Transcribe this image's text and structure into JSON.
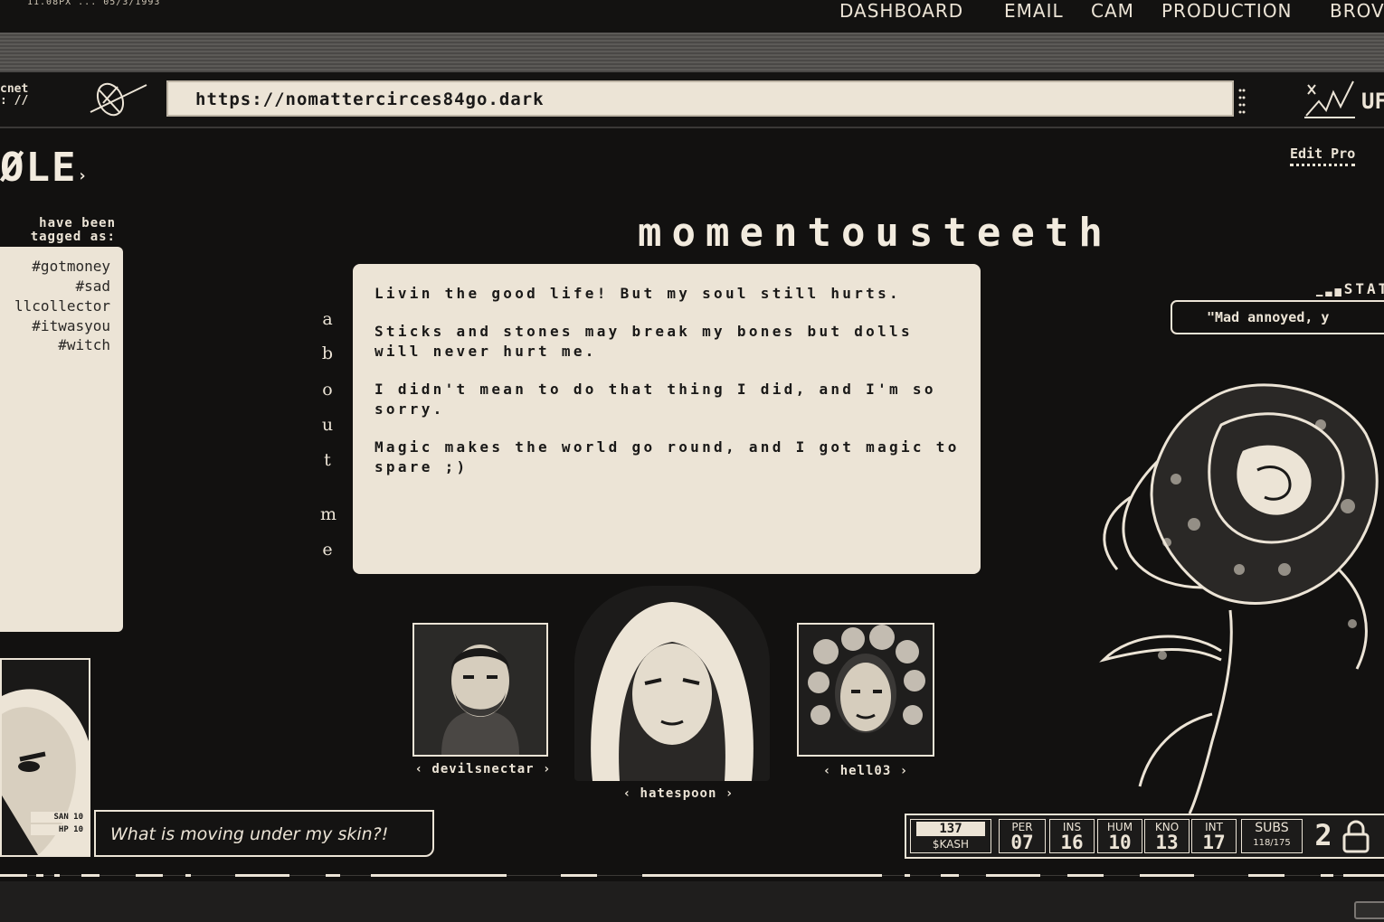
{
  "top_status": "11.08PX ... 05/3/1993",
  "nav": [
    {
      "label": "DASHBOARD"
    },
    {
      "label": "EMAIL"
    },
    {
      "label": "CAM"
    },
    {
      "label": "PRODUCTION"
    },
    {
      "label": "BROV"
    }
  ],
  "browser": {
    "network_label_line1": "cnet",
    "network_label_line2": ": //",
    "url": "https://nomattercirces84go.dark",
    "right_label": "UF"
  },
  "site": {
    "logo": "ØLE",
    "logo_suffix": "›",
    "edit_profile": "Edit Pro"
  },
  "tags": {
    "heading_line1": "have been",
    "heading_line2": "tagged as:",
    "items": [
      "#gotmoney",
      "#sad",
      "llcollector",
      "#itwasyou",
      "#witch"
    ]
  },
  "profile": {
    "name": "momentousteeth",
    "about_label": [
      "a",
      "b",
      "o",
      "u",
      "t",
      "m",
      "e"
    ],
    "about_paragraphs": [
      "Livin the good life! But my soul still hurts.",
      "Sticks and stones may break my bones but dolls will never hurt me.",
      "I didn't mean to do that thing I did, and I'm so sorry.",
      "Magic makes the world go round, and I got magic to spare ;)"
    ],
    "status_label": "STAT",
    "status_text": "\"Mad annoyed, y"
  },
  "friends": [
    {
      "name": "‹ devilsnectar ›"
    },
    {
      "name": "‹ hatespoon ›"
    },
    {
      "name": "‹ hell03 ›"
    }
  ],
  "player": {
    "san_label": "SAN 10",
    "hp_label": "HP 10",
    "dialogue": "What is moving under my skin?!"
  },
  "stats": {
    "cash_value": "137",
    "cash_label": "$KASH",
    "attributes": [
      {
        "label": "PER",
        "value": "07"
      },
      {
        "label": "INS",
        "value": "16"
      },
      {
        "label": "HUM",
        "value": "10"
      },
      {
        "label": "KNO",
        "value": "13"
      },
      {
        "label": "INT",
        "value": "17"
      }
    ],
    "subs_label": "SUBS",
    "subs_value": "118/175",
    "level_value": "2"
  },
  "colors": {
    "background": "#121110",
    "paper": "#ece4d6",
    "ink": "#1a1918"
  }
}
